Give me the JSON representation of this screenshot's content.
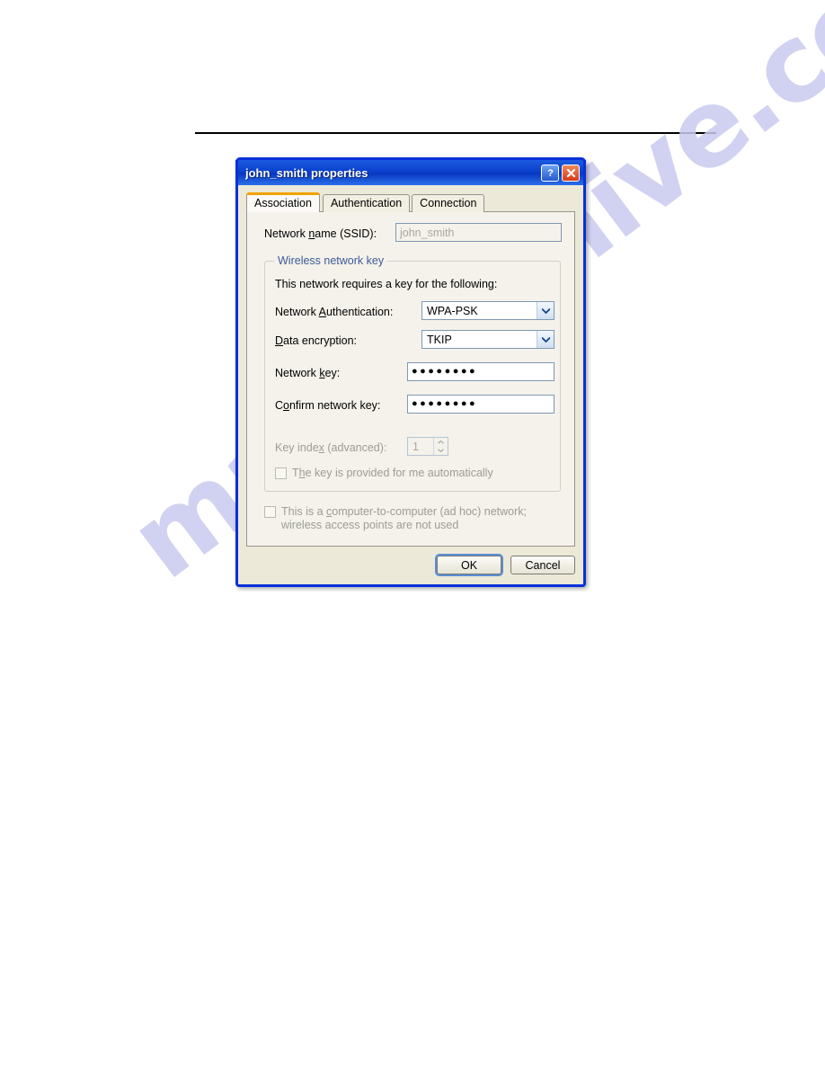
{
  "watermark": {
    "text": "manualshive.com"
  },
  "dialog": {
    "title": "john_smith properties",
    "help_button": "?",
    "close_button": "×",
    "tabs": [
      {
        "label": "Association",
        "selected": true
      },
      {
        "label": "Authentication",
        "selected": false
      },
      {
        "label": "Connection",
        "selected": false
      }
    ],
    "ssid": {
      "label_pre": "Network ",
      "label_key": "n",
      "label_post": "ame (SSID):",
      "value": "john_smith",
      "disabled": true
    },
    "group": {
      "title": "Wireless network key",
      "intro": "This network requires a key for the following:",
      "auth": {
        "label_pre": "Network ",
        "label_key": "A",
        "label_post": "uthentication:",
        "value": "WPA-PSK"
      },
      "encryption": {
        "label_pre": "",
        "label_key": "D",
        "label_post": "ata encryption:",
        "value": "TKIP"
      },
      "network_key": {
        "label_pre": "Network ",
        "label_key": "k",
        "label_post": "ey:",
        "value": "●●●●●●●●"
      },
      "confirm_key": {
        "label_pre": "C",
        "label_key": "o",
        "label_post": "nfirm network key:",
        "value": "●●●●●●●●"
      },
      "key_index": {
        "label_pre": "Key inde",
        "label_key": "x",
        "label_post": " (advanced):",
        "value": "1",
        "disabled": true
      },
      "auto_key": {
        "label_pre": "T",
        "label_key": "h",
        "label_post": "e key is provided for me automatically",
        "checked": false,
        "disabled": true
      }
    },
    "adhoc": {
      "label_pre": "This is a ",
      "label_key": "c",
      "label_post": "omputer-to-computer (ad hoc) network; wireless access points are not used",
      "checked": false,
      "disabled": true
    },
    "buttons": {
      "ok": "OK",
      "cancel": "Cancel"
    }
  }
}
